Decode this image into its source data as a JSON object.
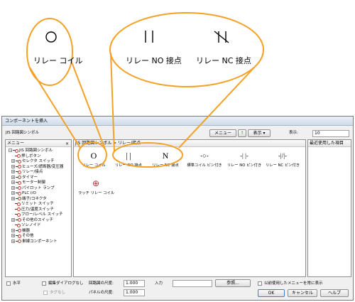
{
  "callouts": {
    "coil": {
      "glyph": "O",
      "label": "リレー コイル"
    },
    "no": {
      "glyph": "||",
      "label": "リレー NO 接点"
    },
    "nc": {
      "glyph": "N",
      "label": "リレー NC 接点"
    }
  },
  "dialog": {
    "title": "コンポーネントを挿入",
    "library": "JIS 回路図シンボル",
    "menu_button": "メニュー",
    "view_button": "表示",
    "display_label": "表示:",
    "display_value": "10",
    "menu_pane_title": "メニュー",
    "symbols_pane_title": "JIS 回路図シンボル > リレー/接点",
    "recent_pane_title": "最近使用した項目",
    "tree": {
      "root": "JIS 回路図シンボル",
      "items": [
        "押しボタン",
        "セレクタ スイッチ",
        "ヒューズ/遮断器/変圧器",
        "リレー/接点",
        "タイマー",
        "モーター制御",
        "パイロット ランプ",
        "PLC I/O",
        "端子/コネクタ",
        "リミット スイッチ",
        "圧力/温度スイッチ",
        "フロー/レベル スイッチ",
        "その他のスイッチ",
        "ソレノイド",
        "機器",
        "その他",
        "単線コンポーネント"
      ]
    },
    "components": [
      {
        "glyph": "O",
        "label": "リレー コイル"
      },
      {
        "glyph": "| |",
        "label": "リレー NO 接点"
      },
      {
        "glyph": "N",
        "label": "リレー NC 接点"
      },
      {
        "glyph": "-○-",
        "label": "標準コイル ピン付き"
      },
      {
        "glyph": "-| |-",
        "label": "リレー NO ピン付き"
      },
      {
        "glyph": "-|/|-",
        "label": "リレー NC ピン付き"
      },
      {
        "glyph": "⊕",
        "label": "ラッチ リレー コイル"
      }
    ],
    "footer": {
      "horizontal": "水平",
      "no_edit_dialog": "編集ダイアログなし",
      "no_tag": "タグなし",
      "schematic_scale_label": "回路図の尺度:",
      "schematic_scale_value": "1.000",
      "panel_scale_label": "パネルの尺度:",
      "panel_scale_value": "1.000",
      "input_label": "入力",
      "browse_button": "参照...",
      "show_prev_menu": "以前使用したメニューを常に表示",
      "ok_button": "OK",
      "cancel_button": "キャンセル",
      "help_button": "ヘルプ"
    }
  },
  "colors": {
    "callout_stroke": "#f4a127",
    "selection_border": "#2b6fcf"
  }
}
